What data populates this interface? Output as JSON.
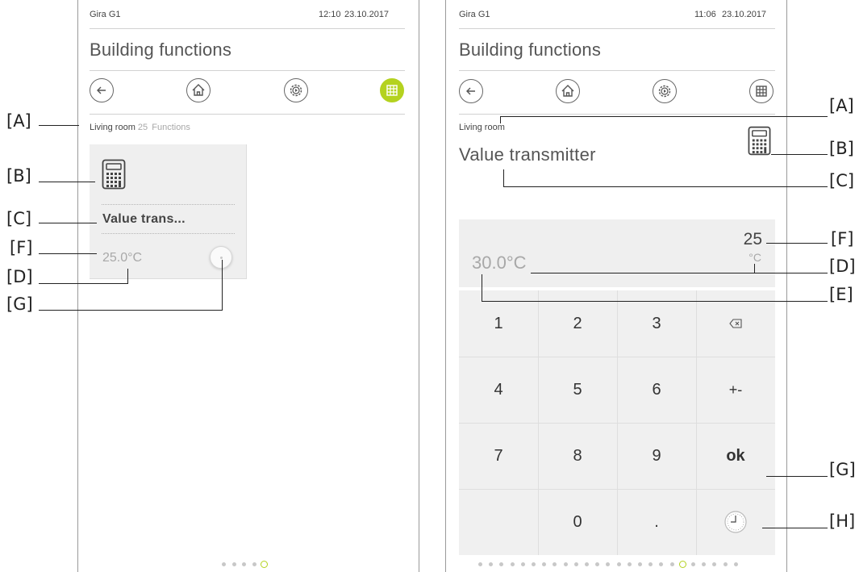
{
  "left": {
    "status_app": "Gira G1",
    "status_time": "12:10",
    "status_date": "23.10.2017",
    "title": "Building functions",
    "breadcrumb_room": "Living room",
    "breadcrumb_count": "25",
    "breadcrumb_label": "Functions",
    "tile_label": "Value trans...",
    "tile_value": "25.0°C",
    "nav_icons": [
      "back-arrow-icon",
      "home-icon",
      "scenes-gear-icon",
      "grid-icon"
    ],
    "active_nav": "grid-icon",
    "page_dots": 5,
    "active_dot": 5
  },
  "right": {
    "status_app": "Gira G1",
    "status_time": "11:06",
    "status_date": "23.10.2017",
    "title": "Building functions",
    "room": "Living room",
    "function_title": "Value transmitter",
    "current_value": "30.0°C",
    "entry_value": "25",
    "entry_unit": "°C",
    "keys": [
      [
        "1",
        "2",
        "3",
        "⌫"
      ],
      [
        "4",
        "5",
        "6",
        "+-"
      ],
      [
        "7",
        "8",
        "9",
        "ok"
      ],
      [
        "",
        "0",
        ".",
        "clock"
      ]
    ],
    "page_dots": 25,
    "active_dot": 20
  },
  "callouts_left": [
    "[A]",
    "[B]",
    "[C]",
    "[F]",
    "[D]",
    "[G]"
  ],
  "callouts_right": [
    "[A]",
    "[B]",
    "[C]",
    "[F]",
    "[D]",
    "[E]",
    "[G]",
    "[H]"
  ],
  "colors": {
    "accent": "#b4d21f",
    "text": "#4a4a4a",
    "muted": "#a8a8a8",
    "panel": "#efefef"
  }
}
